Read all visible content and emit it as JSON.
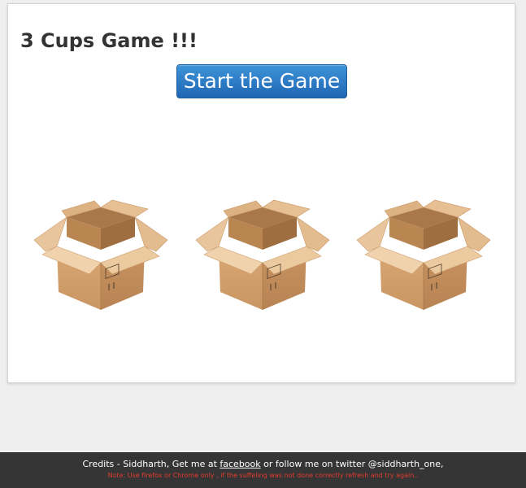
{
  "title": "3 Cups Game !!!",
  "start_button_label": "Start the Game",
  "boxes": [
    {
      "icon": "open-cardboard-box-icon"
    },
    {
      "icon": "open-cardboard-box-icon"
    },
    {
      "icon": "open-cardboard-box-icon"
    }
  ],
  "footer": {
    "credits_prefix": "Credits - Siddharth, Get me at ",
    "facebook_link": "facebook",
    "credits_suffix": " or follow me on twitter @siddharth_one,",
    "note": "Note: Use firefox or Chrome only , if the suffeling was not done correctly refresh and try again.."
  },
  "colors": {
    "button_top": "#3d93d8",
    "button_bottom": "#1f66b3",
    "footer_bg": "#353535",
    "note_text": "#e23b2e",
    "box_light": "#e2b684",
    "box_mid": "#d4a06b",
    "box_dark": "#b98550"
  }
}
